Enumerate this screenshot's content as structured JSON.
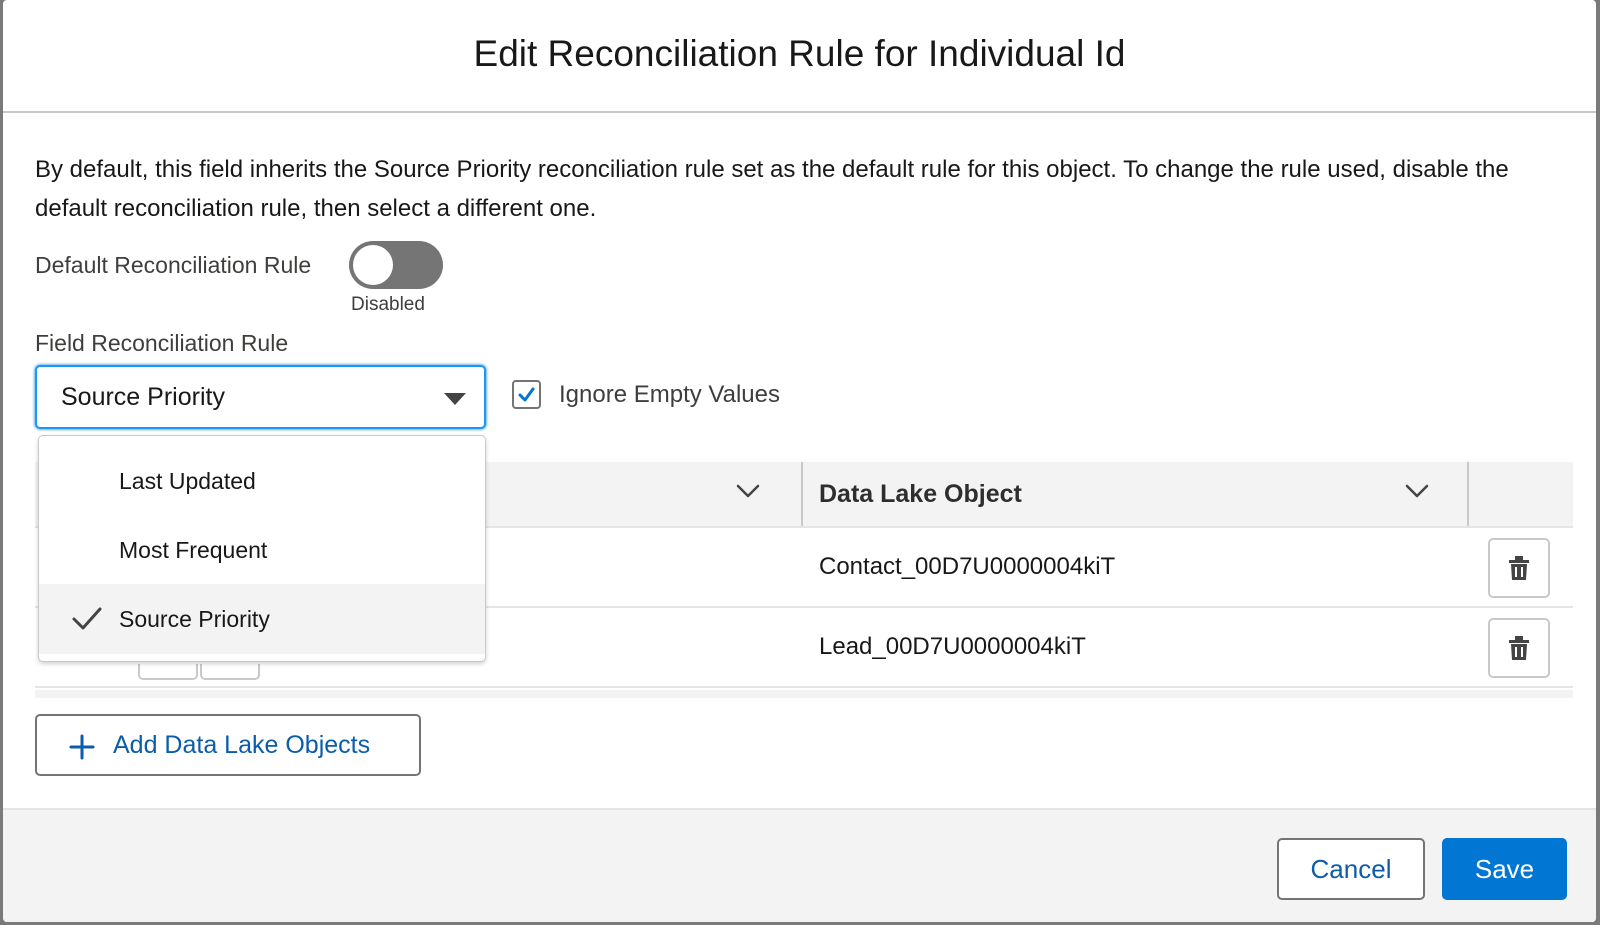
{
  "modal": {
    "title": "Edit Reconciliation Rule for Individual Id",
    "description": "By default, this field inherits the Source Priority reconciliation rule set as the default rule for this object. To change the rule used, disable the default reconciliation rule, then select a different one."
  },
  "default_rule": {
    "label": "Default Reconciliation Rule",
    "state": "Disabled",
    "enabled": false
  },
  "field_rule": {
    "label": "Field Reconciliation Rule",
    "selected": "Source Priority",
    "options": [
      {
        "label": "Last Updated",
        "selected": false
      },
      {
        "label": "Most Frequent",
        "selected": false
      },
      {
        "label": "Source Priority",
        "selected": true
      }
    ]
  },
  "ignore_empty": {
    "label": "Ignore Empty Values",
    "checked": true
  },
  "table": {
    "columns": [
      "",
      "Data Lake Object"
    ],
    "rows": [
      {
        "data_lake_object": "Contact_00D7U0000004kiT"
      },
      {
        "data_lake_object": "Lead_00D7U0000004kiT"
      }
    ]
  },
  "add_button": {
    "label": "Add Data Lake Objects"
  },
  "footer": {
    "cancel_label": "Cancel",
    "save_label": "Save"
  },
  "colors": {
    "brand": "#0176d3",
    "link": "#0b5cab",
    "focus": "#1b96ff"
  },
  "icons": [
    "caret-down-icon",
    "checkbox-check-icon",
    "chevron-down-icon",
    "trash-icon",
    "checkmark-icon",
    "plus-icon"
  ]
}
